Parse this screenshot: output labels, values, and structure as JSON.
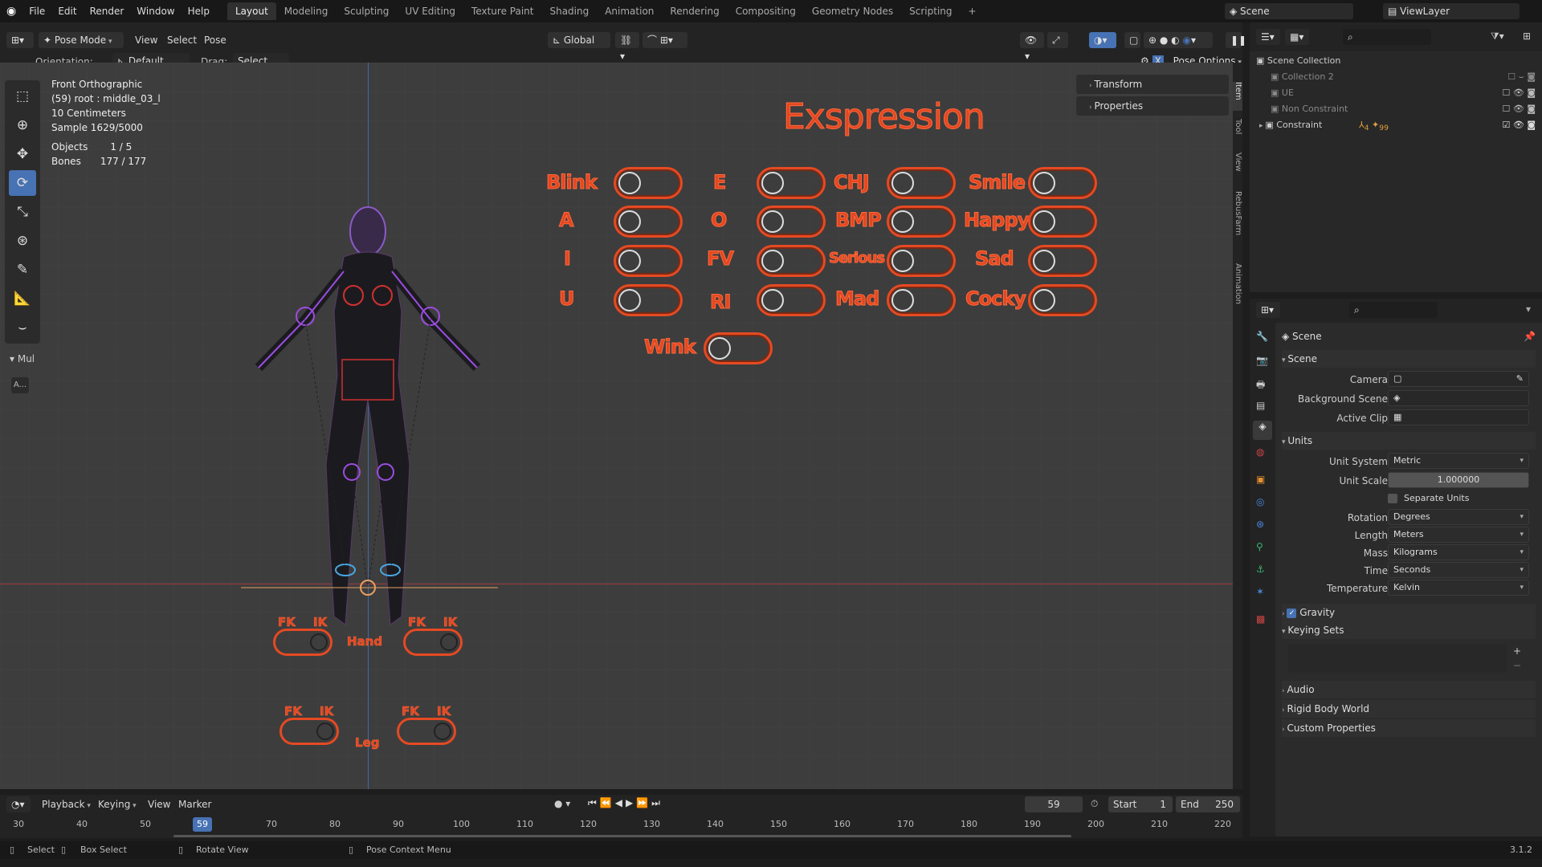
{
  "menubar": {
    "items": [
      "File",
      "Edit",
      "Render",
      "Window",
      "Help"
    ],
    "workspaces": [
      "Layout",
      "Modeling",
      "Sculpting",
      "UV Editing",
      "Texture Paint",
      "Shading",
      "Animation",
      "Rendering",
      "Compositing",
      "Geometry Nodes",
      "Scripting"
    ],
    "active_workspace": "Layout",
    "scene": "Scene",
    "view_layer": "ViewLayer"
  },
  "viewport_header": {
    "mode": "Pose Mode",
    "menus": [
      "View",
      "Select",
      "Pose"
    ],
    "orientation_transform": "Global",
    "orientation_label": "Orientation:",
    "orientation_value": "Default",
    "drag_label": "Drag:",
    "drag_value": "Select Box",
    "pose_options": "Pose Options"
  },
  "overlay_info": {
    "view": "Front Orthographic",
    "bone": "(59) root : middle_03_l",
    "scale": "10 Centimeters",
    "sample": "Sample 1629/5000",
    "objects_label": "Objects",
    "objects_value": "1 / 5",
    "bones_label": "Bones",
    "bones_value": "177 / 177"
  },
  "tool_panel": {
    "label": "Mul",
    "button": "A..."
  },
  "expression": {
    "title": "Exspression",
    "labels": [
      "Blink",
      "A",
      "I",
      "U",
      "E",
      "O",
      "FV",
      "RI",
      "CHJ",
      "BMP",
      "Serious",
      "Mad",
      "Smile",
      "Happy",
      "Sad",
      "Cocky",
      "Wink"
    ]
  },
  "rig_controls": {
    "fk": "FK",
    "ik": "IK",
    "hand": "Hand",
    "leg": "Leg"
  },
  "npanel": {
    "transform": "Transform",
    "properties": "Properties"
  },
  "side_tabs": [
    "Item",
    "Tool",
    "View",
    "RebusFarm",
    "Animation"
  ],
  "outliner": {
    "root": "Scene Collection",
    "items": [
      "Collection 2",
      "UE",
      "Non Constraint",
      "Constraint"
    ],
    "constraint_badge": "4",
    "constraint_count": "99"
  },
  "properties": {
    "context": "Scene",
    "scene_section": "Scene",
    "camera_label": "Camera",
    "background_label": "Background Scene",
    "clip_label": "Active Clip",
    "units_section": "Units",
    "unit_system_label": "Unit System",
    "unit_system": "Metric",
    "unit_scale_label": "Unit Scale",
    "unit_scale": "1.000000",
    "separate_units": "Separate Units",
    "rotation_label": "Rotation",
    "rotation": "Degrees",
    "length_label": "Length",
    "length": "Meters",
    "mass_label": "Mass",
    "mass": "Kilograms",
    "time_label": "Time",
    "time": "Seconds",
    "temperature_label": "Temperature",
    "temperature": "Kelvin",
    "gravity": "Gravity",
    "keying_sets": "Keying Sets",
    "audio": "Audio",
    "rigid_body": "Rigid Body World",
    "custom_props": "Custom Properties"
  },
  "timeline": {
    "menus": [
      "Playback",
      "Keying",
      "View",
      "Marker"
    ],
    "current_frame": "59",
    "start_label": "Start",
    "start": "1",
    "end_label": "End",
    "end": "250",
    "ticks": [
      "30",
      "40",
      "50",
      "59",
      "70",
      "80",
      "90",
      "100",
      "110",
      "120",
      "130",
      "140",
      "150",
      "160",
      "170",
      "180",
      "190",
      "200",
      "210",
      "220"
    ]
  },
  "statusbar": {
    "select": "Select",
    "box_select": "Box Select",
    "rotate_view": "Rotate View",
    "pose_context": "Pose Context Menu",
    "version": "3.1.2"
  },
  "colors": {
    "accent": "#4772b3",
    "rig": "#e34722",
    "bg": "#3d3d3d"
  }
}
